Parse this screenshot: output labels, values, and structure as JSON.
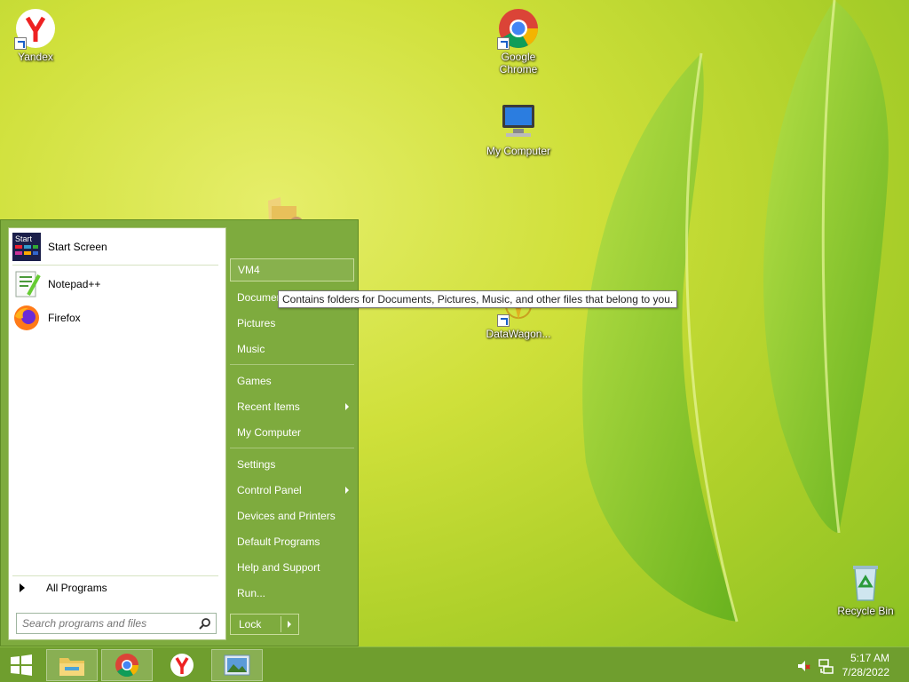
{
  "desktop": {
    "icons": [
      {
        "label": "Yandex",
        "icon": "yandex-icon"
      },
      {
        "label": "Google Chrome",
        "icon": "chrome-icon"
      },
      {
        "label": "My Computer",
        "icon": "computer-icon"
      },
      {
        "label": "DataWagon...",
        "icon": "datawagon-icon"
      },
      {
        "label": "Recycle Bin",
        "icon": "recycle-bin-icon"
      }
    ]
  },
  "start_menu": {
    "pinned": [
      {
        "label": "Start Screen",
        "icon": "start-screen-icon"
      },
      {
        "label": "Notepad++",
        "icon": "notepadpp-icon"
      },
      {
        "label": "Firefox",
        "icon": "firefox-icon"
      }
    ],
    "all_programs": "All Programs",
    "search_placeholder": "Search programs and files",
    "right": {
      "user": "VM4",
      "documents": "Documents",
      "pictures": "Pictures",
      "music": "Music",
      "games": "Games",
      "recent_items": "Recent Items",
      "my_computer": "My Computer",
      "settings": "Settings",
      "control_panel": "Control Panel",
      "devices_printers": "Devices and Printers",
      "default_programs": "Default Programs",
      "help_support": "Help and Support",
      "run": "Run..."
    },
    "lock": "Lock",
    "tooltip": "Contains folders for Documents, Pictures, Music, and other files that belong to you."
  },
  "taskbar": {
    "time": "5:17 AM",
    "date": "7/28/2022"
  },
  "colors": {
    "menu_bg": "#7eab3e",
    "taskbar_bg": "#6f9e2e"
  }
}
